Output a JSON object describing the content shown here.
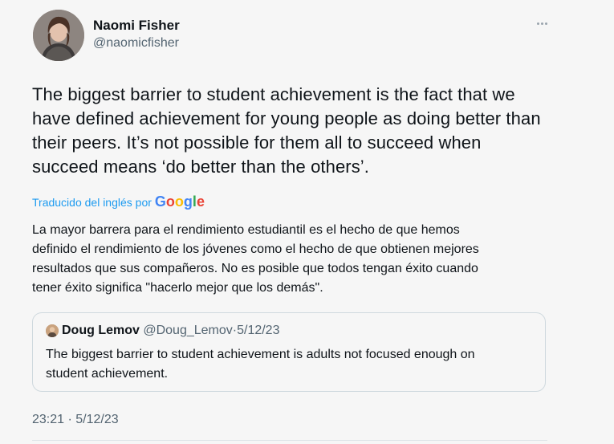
{
  "author": {
    "name": "Naomi Fisher",
    "handle": "@naomicfisher"
  },
  "tweet": {
    "text": "The biggest barrier to student achievement is the fact that we\nhave defined achievement for young people as doing better than\ntheir peers. It’s not possible for them all to succeed when\nsucceed means ‘do better than the others’."
  },
  "translation": {
    "label": "Traducido del inglés por",
    "provider": "Google",
    "text": "La mayor barrera para el rendimiento estudiantil es el hecho de que hemos\ndefinido el rendimiento de los jóvenes como el hecho de que obtienen mejores\nresultados que sus compañeros. No es posible que todos tengan éxito cuando\ntener éxito significa \"hacerlo mejor que los demás\"."
  },
  "quoted_tweet": {
    "name": "Doug Lemov",
    "handle": "@Doug_Lemov",
    "separator": "·",
    "date": "5/12/23",
    "text": "The biggest barrier to student achievement is adults not focused enough on\nstudent achievement."
  },
  "meta": {
    "time": "23:21",
    "separator": "·",
    "date": "5/12/23"
  },
  "icons": {
    "more": "more-horizontal-icon"
  },
  "colors": {
    "accent": "#1d9bf0",
    "secondary_text": "#536471",
    "primary_text": "#0f1419",
    "border": "#cfd9de"
  }
}
